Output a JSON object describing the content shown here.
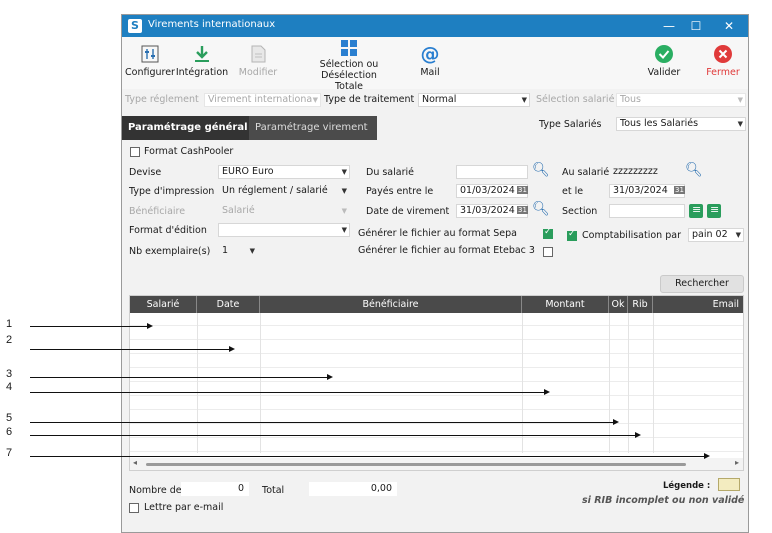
{
  "window": {
    "title": "Virements internationaux",
    "app_icon": "S"
  },
  "toolbar": {
    "configurer": "Configurer",
    "integration": "Intégration",
    "modifier": "Modifier",
    "selection_line1": "Sélection ou",
    "selection_line2": "Désélection Totale",
    "mail": "Mail",
    "valider": "Valider",
    "fermer": "Fermer"
  },
  "filters": {
    "type_reglement_label": "Type réglement",
    "type_reglement_value": "Virement internationa",
    "type_traitement_label": "Type de traitement",
    "type_traitement_value": "Normal",
    "selection_salarie_label": "Sélection salarié",
    "selection_salarie_value": "Tous"
  },
  "tabs": {
    "general": "Paramétrage général",
    "virement": "Paramétrage virement"
  },
  "type_salaries": {
    "label": "Type Salariés",
    "value": "Tous les Salariés"
  },
  "form": {
    "format_cashpooler": "Format CashPooler",
    "devise_label": "Devise",
    "devise_value": "EURO Euro",
    "type_impression_label": "Type d'impression",
    "type_impression_value": "Un réglement / salarié",
    "beneficiaire_label": "Bénéficiaire",
    "beneficiaire_value": "Salarié",
    "format_edition_label": "Format d'édition",
    "format_edition_value": "",
    "nb_exemplaires_label": "Nb exemplaire(s)",
    "nb_exemplaires_value": "1",
    "du_salarie_label": "Du salarié",
    "du_salarie_value": "",
    "au_salarie_label": "Au salarié",
    "au_salarie_value": "zzzzzzzzz",
    "payes_entre_label": "Payés entre le",
    "payes_entre_value": "01/03/2024",
    "et_le_label": "et le",
    "et_le_value": "31/03/2024",
    "date_virement_label": "Date de virement",
    "date_virement_value": "31/03/2024",
    "section_label": "Section",
    "section_value": "",
    "sepa_label": "Générer le fichier au format Sepa",
    "etebac_label": "Générer le fichier au format Etebac 3",
    "compta_label": "Comptabilisation par",
    "compta_value": "pain 02",
    "calendar_glyph": "31"
  },
  "rechercher": "Rechercher",
  "grid": {
    "columns": [
      "Salarié",
      "Date",
      "Bénéficiaire",
      "Montant",
      "Ok",
      "Rib",
      "Email"
    ],
    "rows": []
  },
  "footer": {
    "nombre_de_label": "Nombre de",
    "nombre_de_value": "0",
    "total_label": "Total",
    "total_value": "0,00",
    "legende_label": "Légende :",
    "legende_note": "si RIB incomplet ou non validé",
    "lettre_email": "Lettre par e-mail"
  },
  "callouts": [
    "1",
    "2",
    "3",
    "4",
    "5",
    "6",
    "7"
  ],
  "colors": {
    "titlebar": "#1e7fc1",
    "accent_green": "#2a9d5c",
    "close_red": "#e03a3a",
    "tab_active": "#333333",
    "tab_inactive": "#4b4b4b"
  }
}
